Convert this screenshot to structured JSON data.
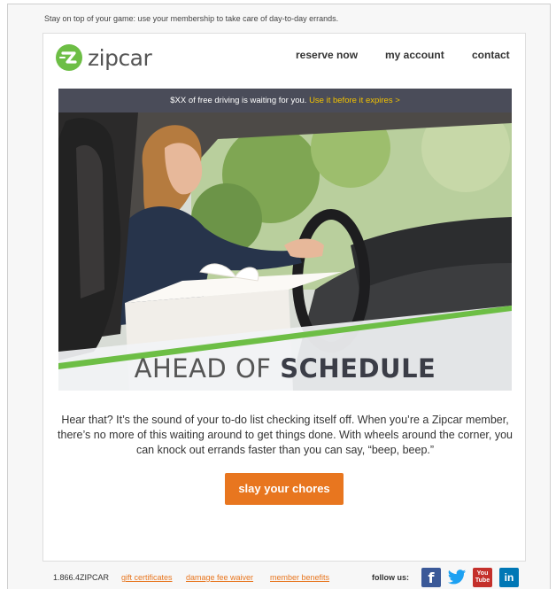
{
  "preheader": "Stay on top of your game: use your membership to take care of day-to-day errands.",
  "header": {
    "logo_text": "zipcar",
    "logo_tm": ".",
    "nav": [
      "reserve now",
      "my account",
      "contact"
    ]
  },
  "banner": {
    "text": "$XX of free driving is waiting for you.",
    "cta": "Use it before it expires  >"
  },
  "hero": {
    "title_light": "AHEAD OF ",
    "title_bold": "SCHEDULE"
  },
  "body_copy": "Hear that? It’s the sound of your to-do list checking itself off. When you’re a Zipcar member, there’s no more of this waiting around to get things done. With wheels around the corner, you can knock out errands faster than you can say, “beep, beep.”",
  "cta_button": "slay your chores",
  "footer": {
    "phone": "1.866.4ZIPCAR",
    "links": [
      "gift certificates",
      "damage fee waiver",
      "member benefits"
    ],
    "follow_label": "follow us:",
    "social": [
      {
        "name": "facebook",
        "glyph": "f",
        "color": "#3b5998"
      },
      {
        "name": "twitter",
        "glyph": "t",
        "color": "#1da1f2"
      },
      {
        "name": "youtube",
        "glyph": "You Tube",
        "color": "#c4302b"
      },
      {
        "name": "linkedin",
        "glyph": "in",
        "color": "#0077b5"
      }
    ]
  },
  "colors": {
    "brand_green": "#6dbe45",
    "accent_orange": "#e8761f",
    "banner_bg": "#4a4c59",
    "banner_cta": "#f2c200"
  }
}
